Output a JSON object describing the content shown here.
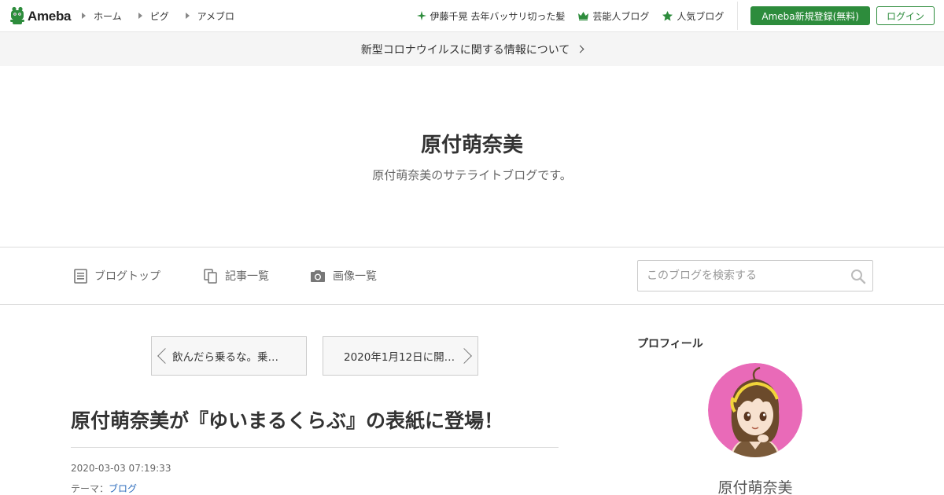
{
  "header": {
    "logo_text": "Ameba",
    "nav": [
      {
        "label": "ホーム"
      },
      {
        "label": "ピグ"
      },
      {
        "label": "アメブロ"
      }
    ],
    "trending": [
      {
        "label": "伊藤千晃 去年バッサリ切った髪",
        "icon": "sparkle-icon"
      },
      {
        "label": "芸能人ブログ",
        "icon": "crown-icon"
      },
      {
        "label": "人気ブログ",
        "icon": "star-icon"
      }
    ],
    "register_label": "Ameba新規登録(無料)",
    "login_label": "ログイン",
    "accent_color": "#2d8c3c"
  },
  "notice": {
    "text": "新型コロナウイルスに関する情報について"
  },
  "blog": {
    "title": "原付萌奈美",
    "description": "原付萌奈美のサテライトブログです。"
  },
  "blognav": {
    "items": [
      {
        "label": "ブログトップ",
        "icon": "document-icon"
      },
      {
        "label": "記事一覧",
        "icon": "copy-icon"
      },
      {
        "label": "画像一覧",
        "icon": "camera-icon"
      }
    ],
    "search_placeholder": "このブログを検索する"
  },
  "pager": {
    "prev_label": "飲んだら乗るな。乗…",
    "next_label": "2020年1月12日に開…"
  },
  "article": {
    "title": "原付萌奈美が『ゆいまるくらぶ』の表紙に登場！",
    "date": "2020-03-03 07:19:33",
    "theme_prefix": "テーマ：",
    "theme_link": "ブログ",
    "link_color": "#2e6dbc"
  },
  "sidebar": {
    "profile_heading": "プロフィール",
    "profile_name": "原付萌奈美",
    "avatar_bg": "#e96ab8"
  }
}
